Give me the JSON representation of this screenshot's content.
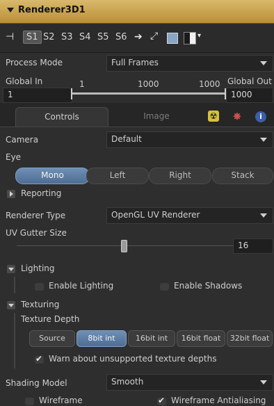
{
  "header": {
    "title": "Renderer3D1"
  },
  "toolbar": {
    "slots": [
      "S1",
      "S2",
      "S3",
      "S4",
      "S5",
      "S6"
    ],
    "active_slot": "S1"
  },
  "process_mode": {
    "label": "Process Mode",
    "value": "Full Frames"
  },
  "global_range": {
    "in_label": "Global In",
    "in_value": "1",
    "out_label": "Global Out",
    "out_value": "1000",
    "ticks": [
      "1",
      "1000",
      "1000"
    ]
  },
  "tabs": {
    "controls": "Controls",
    "image": "Image"
  },
  "camera": {
    "label": "Camera",
    "value": "Default"
  },
  "eye": {
    "label": "Eye",
    "options": [
      "Mono",
      "Left",
      "Right",
      "Stack"
    ],
    "selected": "Mono"
  },
  "reporting": {
    "label": "Reporting"
  },
  "renderer_type": {
    "label": "Renderer Type",
    "value": "OpenGL UV Renderer"
  },
  "uv_gutter": {
    "label": "UV Gutter Size",
    "value": "16"
  },
  "lighting": {
    "label": "Lighting",
    "enable_lighting": "Enable Lighting",
    "enable_shadows": "Enable Shadows"
  },
  "texturing": {
    "label": "Texturing",
    "depth_label": "Texture Depth",
    "options": [
      "Source",
      "8bit int",
      "16bit int",
      "16bit float",
      "32bit float"
    ],
    "selected": "8bit int",
    "warn_label": "Warn about unsupported texture depths",
    "warn_checked": true
  },
  "shading_model": {
    "label": "Shading Model",
    "value": "Smooth"
  },
  "wireframe": {
    "label": "Wireframe",
    "checked": false
  },
  "wireframe_aa": {
    "label": "Wireframe Antialiasing",
    "checked": true
  },
  "colors": {
    "accent": "#5b7ba3",
    "header": "#c9a24f"
  }
}
